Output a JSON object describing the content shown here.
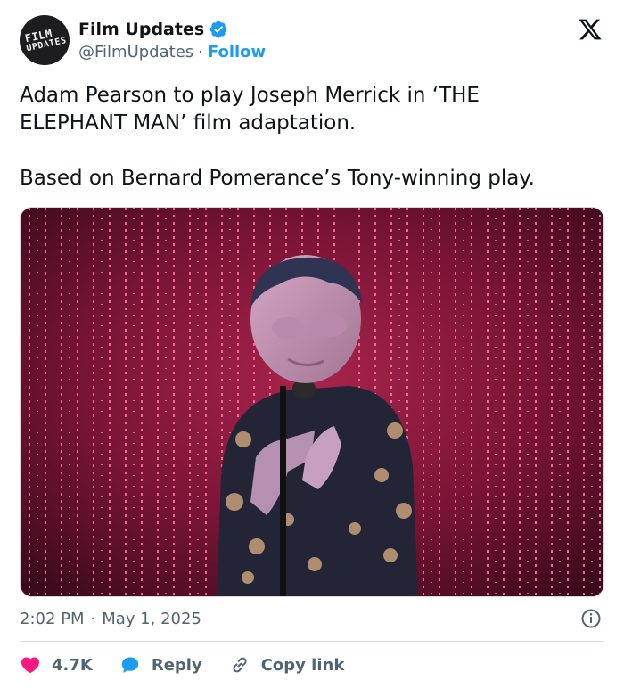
{
  "header": {
    "avatar_line1": "FILM",
    "avatar_line2": "UPDATES",
    "display_name": "Film Updates",
    "handle": "@FilmUpdates",
    "separator": "·",
    "follow_label": "Follow"
  },
  "tweet": {
    "paragraph1": "Adam Pearson to play Joseph Merrick in ‘THE\nELEPHANT MAN’ film adaptation.",
    "paragraph2": "Based on Bernard Pomerance’s Tony-winning play."
  },
  "media": {
    "description_icon": "photo"
  },
  "meta": {
    "time": "2:02 PM",
    "separator": "·",
    "date": "May 1, 2025"
  },
  "actions": {
    "likes_count": "4.7K",
    "reply_label": "Reply",
    "copy_link_label": "Copy link"
  },
  "colors": {
    "accent": "#1d9bf0",
    "like": "#f91880",
    "muted": "#536471",
    "text": "#0f1419"
  }
}
